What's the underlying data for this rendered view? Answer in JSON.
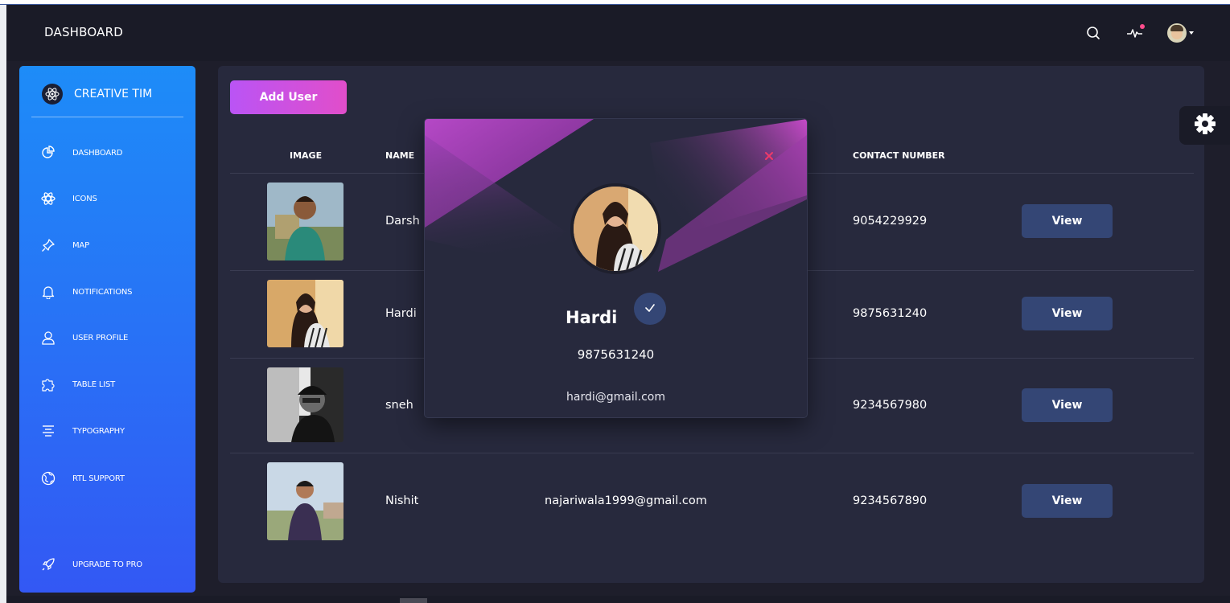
{
  "navbar": {
    "title": "DASHBOARD",
    "icons": [
      "search-icon",
      "activity-icon",
      "avatar"
    ]
  },
  "sidebar": {
    "logo_text": "CREATIVE TIM",
    "items": [
      {
        "label": "DASHBOARD",
        "icon": "chart-pie-icon"
      },
      {
        "label": "ICONS",
        "icon": "atom-icon"
      },
      {
        "label": "MAP",
        "icon": "pin-icon"
      },
      {
        "label": "NOTIFICATIONS",
        "icon": "bell-icon"
      },
      {
        "label": "USER PROFILE",
        "icon": "user-icon"
      },
      {
        "label": "TABLE LIST",
        "icon": "puzzle-icon"
      },
      {
        "label": "TYPOGRAPHY",
        "icon": "align-center-icon"
      },
      {
        "label": "RTL SUPPORT",
        "icon": "world-icon"
      }
    ],
    "upgrade_label": "UPGRADE TO PRO"
  },
  "main": {
    "add_user_label": "Add User",
    "headers": {
      "image": "IMAGE",
      "name": "NAME",
      "contact": "CONTACT NUMBER"
    },
    "rows": [
      {
        "name": "Darsh",
        "email": "",
        "contact": "9054229929",
        "action": "View"
      },
      {
        "name": "Hardi",
        "email": "",
        "contact": "9875631240",
        "action": "View"
      },
      {
        "name": "sneh",
        "email": "",
        "contact": "9234567980",
        "action": "View"
      },
      {
        "name": "Nishit",
        "email": "najariwala1999@gmail.com",
        "contact": "9234567890",
        "action": "View"
      }
    ]
  },
  "modal": {
    "name": "Hardi",
    "phone": "9875631240",
    "email": "hardi@gmail.com"
  },
  "colors": {
    "sidebar_top": "#1d8cf8",
    "sidebar_bottom": "#3358f4",
    "panel": "#27293d",
    "accent_pink": "#e14eca",
    "view_button": "#344675"
  }
}
